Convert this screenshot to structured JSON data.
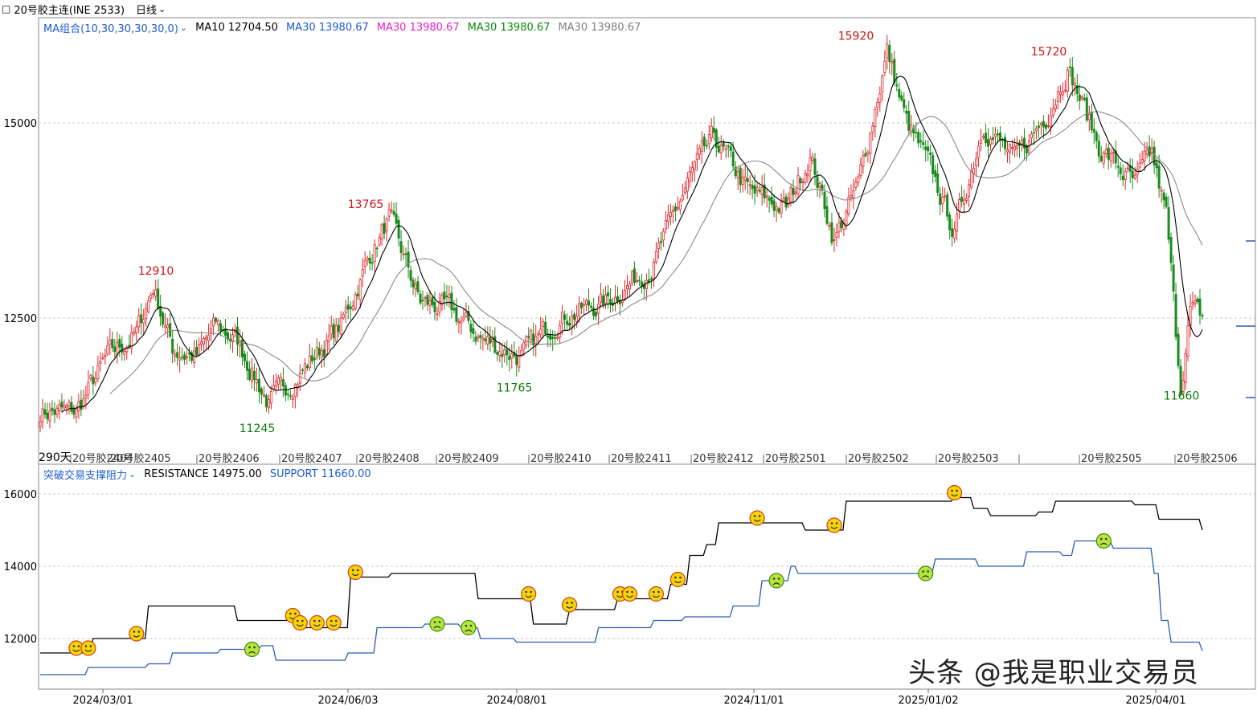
{
  "window": {
    "icon": "window-icon",
    "title": "20号胶主连(INE 2533)",
    "period": "日线"
  },
  "main_legend": {
    "selector": "MA组合(10,30,30,30,30,0)",
    "items": [
      {
        "label": "MA10 12704.50",
        "color": "#000000"
      },
      {
        "label": "MA30 13980.67",
        "color": "#1c5bd8"
      },
      {
        "label": "MA30 13980.67",
        "color": "#e81ec8"
      },
      {
        "label": "MA30 13980.67",
        "color": "#0a8a0a"
      },
      {
        "label": "MA30 13980.67",
        "color": "#808080"
      }
    ]
  },
  "main_price_ticks": [
    "15000",
    "12500"
  ],
  "contract_labels": [
    "20号胶2404",
    "20号胶2405",
    "20号胶2406",
    "20号胶2407",
    "20号胶2408",
    "20号胶2409",
    "20号胶2410",
    "20号胶2411",
    "20号胶2412",
    "20号胶2501",
    "20号胶2502",
    "20号胶2503",
    "20号胶2505",
    "20号胶2506"
  ],
  "days_label": "290天",
  "sub_legend": {
    "selector": "突破交易支撑阻力",
    "resistance": "RESISTANCE 14975.00",
    "support": "SUPPORT 11660.00"
  },
  "sub_price_ticks": [
    "16000",
    "14000",
    "12000"
  ],
  "date_axis": [
    "2024/03/01",
    "2024/06/03",
    "2024/08/01",
    "2024/11/01",
    "2025/01/02",
    "2025/04/01"
  ],
  "watermark": "头条 @我是职业交易员",
  "colors": {
    "up": "#e0262b",
    "down": "#1a8a1a",
    "resistance": "#000000",
    "support": "#2a5db0",
    "grid": "#c8c8c8",
    "emoji_fill": "#f5d90a"
  },
  "chart_data": [
    {
      "type": "candlestick",
      "title": "20号胶主连(INE 2533)",
      "period": "日线",
      "ylim": [
        10500,
        16500
      ],
      "y_ticks": [
        15000,
        12500
      ],
      "annotations": [
        {
          "date": "2024-03-12",
          "value": 12910,
          "kind": "high"
        },
        {
          "date": "2024-05-15",
          "value": 11245,
          "kind": "low"
        },
        {
          "date": "2024-06-07",
          "value": 13765,
          "kind": "high"
        },
        {
          "date": "2024-08-02",
          "value": 11765,
          "kind": "low"
        },
        {
          "date": "2024-12-10",
          "value": 15920,
          "kind": "high"
        },
        {
          "date": "2025-03-03",
          "value": 15720,
          "kind": "high"
        },
        {
          "date": "2025-04-07",
          "value": 11660,
          "kind": "low"
        }
      ],
      "series": [
        {
          "name": "MA10",
          "last": 12704.5
        },
        {
          "name": "MA30",
          "last": 13980.67
        }
      ],
      "anchors": [
        {
          "d": 0,
          "v": 11300
        },
        {
          "d": 15,
          "v": 11300
        },
        {
          "d": 28,
          "v": 12000
        },
        {
          "d": 40,
          "v": 12300
        },
        {
          "d": 47,
          "v": 12910
        },
        {
          "d": 55,
          "v": 12100
        },
        {
          "d": 65,
          "v": 12000
        },
        {
          "d": 73,
          "v": 12400
        },
        {
          "d": 82,
          "v": 12200
        },
        {
          "d": 95,
          "v": 11400
        },
        {
          "d": 108,
          "v": 11800
        },
        {
          "d": 125,
          "v": 12400
        },
        {
          "d": 137,
          "v": 13300
        },
        {
          "d": 145,
          "v": 13765
        },
        {
          "d": 158,
          "v": 12700
        },
        {
          "d": 170,
          "v": 12600
        },
        {
          "d": 185,
          "v": 12200
        },
        {
          "d": 200,
          "v": 12000
        },
        {
          "d": 215,
          "v": 12500
        },
        {
          "d": 235,
          "v": 12700
        },
        {
          "d": 255,
          "v": 13200
        },
        {
          "d": 270,
          "v": 14300
        },
        {
          "d": 280,
          "v": 14800
        },
        {
          "d": 295,
          "v": 14100
        },
        {
          "d": 310,
          "v": 13900
        },
        {
          "d": 320,
          "v": 14600
        },
        {
          "d": 330,
          "v": 13500
        },
        {
          "d": 340,
          "v": 14200
        },
        {
          "d": 352,
          "v": 15920
        },
        {
          "d": 360,
          "v": 15000
        },
        {
          "d": 370,
          "v": 14400
        },
        {
          "d": 380,
          "v": 13600
        },
        {
          "d": 392,
          "v": 15000
        },
        {
          "d": 405,
          "v": 14500
        },
        {
          "d": 418,
          "v": 15100
        },
        {
          "d": 427,
          "v": 15720
        },
        {
          "d": 440,
          "v": 14700
        },
        {
          "d": 455,
          "v": 14200
        },
        {
          "d": 462,
          "v": 14600
        },
        {
          "d": 468,
          "v": 13800
        },
        {
          "d": 470,
          "v": 13100
        },
        {
          "d": 472,
          "v": 12300
        },
        {
          "d": 474,
          "v": 11660
        },
        {
          "d": 478,
          "v": 12600
        },
        {
          "d": 483,
          "v": 12500
        }
      ]
    },
    {
      "type": "line",
      "title": "突破交易支撑阻力",
      "ylim": [
        11000,
        16500
      ],
      "y_ticks": [
        16000,
        14000,
        12000
      ],
      "x": [
        "2024-02-02",
        "2024-03-01",
        "2024-06-03",
        "2024-08-01",
        "2024-11-01",
        "2025-01-02",
        "2025-04-01",
        "2025-04-10"
      ],
      "series": [
        {
          "name": "RESISTANCE",
          "last": 14975.0,
          "steps": [
            [
              0,
              11600
            ],
            [
              22,
              12000
            ],
            [
              45,
              12900
            ],
            [
              82,
              12500
            ],
            [
              106,
              12300
            ],
            [
              129,
              13700
            ],
            [
              146,
              13800
            ],
            [
              175,
              13800
            ],
            [
              182,
              13100
            ],
            [
              205,
              12400
            ],
            [
              220,
              12800
            ],
            [
              240,
              13100
            ],
            [
              262,
              13500
            ],
            [
              270,
              14300
            ],
            [
              277,
              14600
            ],
            [
              282,
              15200
            ],
            [
              310,
              15200
            ],
            [
              318,
              15000
            ],
            [
              335,
              15800
            ],
            [
              380,
              15900
            ],
            [
              388,
              15600
            ],
            [
              395,
              15400
            ],
            [
              415,
              15500
            ],
            [
              422,
              15800
            ],
            [
              455,
              15700
            ],
            [
              465,
              15300
            ],
            [
              483,
              15000
            ]
          ]
        },
        {
          "name": "SUPPORT",
          "last": 11660.0,
          "steps": [
            [
              0,
              11000
            ],
            [
              20,
              11200
            ],
            [
              45,
              11300
            ],
            [
              55,
              11600
            ],
            [
              75,
              11700
            ],
            [
              92,
              11800
            ],
            [
              98,
              11400
            ],
            [
              118,
              11400
            ],
            [
              128,
              11600
            ],
            [
              140,
              12300
            ],
            [
              160,
              12400
            ],
            [
              175,
              12300
            ],
            [
              183,
              12000
            ],
            [
              198,
              11900
            ],
            [
              225,
              11900
            ],
            [
              232,
              12300
            ],
            [
              255,
              12500
            ],
            [
              268,
              12600
            ],
            [
              280,
              12600
            ],
            [
              288,
              12900
            ],
            [
              300,
              13600
            ],
            [
              312,
              14000
            ],
            [
              315,
              13800
            ],
            [
              352,
              13800
            ],
            [
              372,
              14200
            ],
            [
              390,
              14000
            ],
            [
              410,
              14400
            ],
            [
              425,
              14300
            ],
            [
              430,
              14700
            ],
            [
              446,
              14500
            ],
            [
              460,
              14500
            ],
            [
              463,
              13800
            ],
            [
              466,
              12500
            ],
            [
              470,
              11900
            ],
            [
              483,
              11660
            ]
          ]
        }
      ],
      "signals": [
        {
          "d": 15,
          "kind": "up-smile"
        },
        {
          "d": 20,
          "kind": "up-smile"
        },
        {
          "d": 40,
          "kind": "up-smile"
        },
        {
          "d": 88,
          "kind": "down-frown"
        },
        {
          "d": 105,
          "kind": "up-smile"
        },
        {
          "d": 108,
          "kind": "up-smile"
        },
        {
          "d": 115,
          "kind": "up-smile"
        },
        {
          "d": 122,
          "kind": "up-smile"
        },
        {
          "d": 131,
          "kind": "up-smile"
        },
        {
          "d": 165,
          "kind": "down-frown"
        },
        {
          "d": 178,
          "kind": "down-frown"
        },
        {
          "d": 203,
          "kind": "up-smile"
        },
        {
          "d": 220,
          "kind": "up-smile"
        },
        {
          "d": 241,
          "kind": "up-smile"
        },
        {
          "d": 245,
          "kind": "up-smile"
        },
        {
          "d": 256,
          "kind": "up-smile"
        },
        {
          "d": 265,
          "kind": "up-smile"
        },
        {
          "d": 298,
          "kind": "up-smile"
        },
        {
          "d": 306,
          "kind": "down-frown"
        },
        {
          "d": 330,
          "kind": "up-smile"
        },
        {
          "d": 368,
          "kind": "down-frown"
        },
        {
          "d": 380,
          "kind": "up-smile"
        },
        {
          "d": 442,
          "kind": "down-frown"
        }
      ]
    }
  ]
}
